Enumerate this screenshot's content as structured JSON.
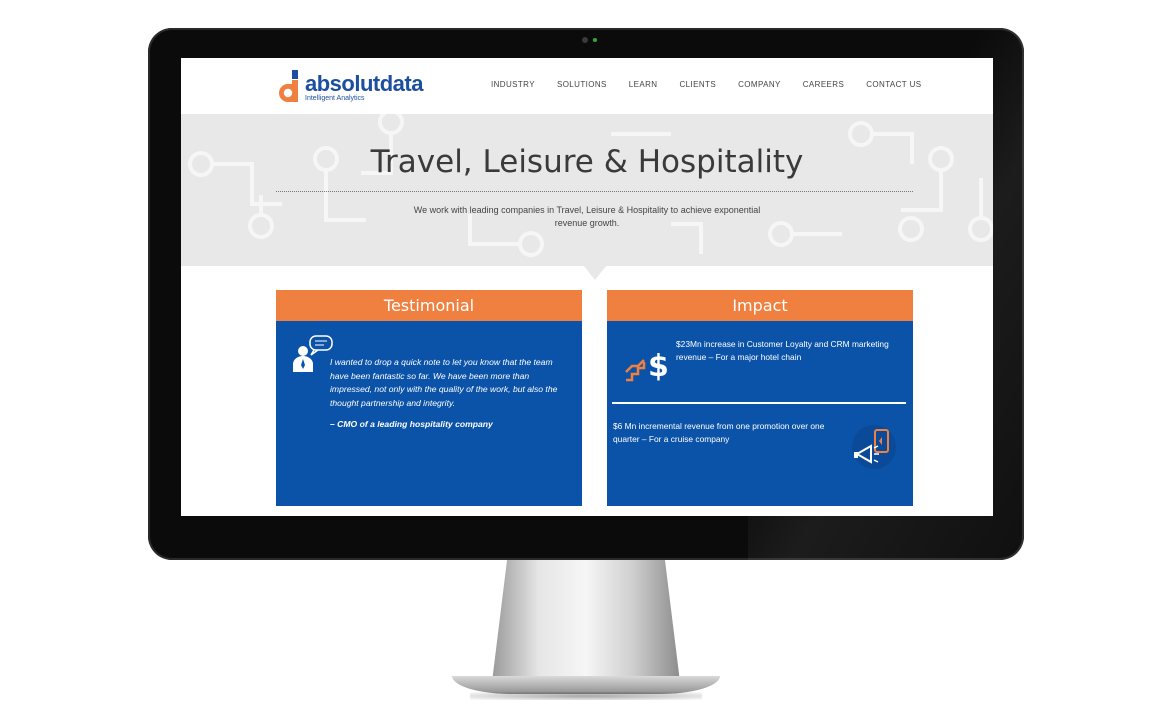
{
  "brand": {
    "name": "absolutdata",
    "tagline": "Intelligent Analytics",
    "logo_mark": "orange-d-logo",
    "colors": {
      "blue": "#1d4fa0",
      "orange": "#f08040"
    }
  },
  "nav": {
    "items": [
      {
        "label": "INDUSTRY"
      },
      {
        "label": "SOLUTIONS"
      },
      {
        "label": "LEARN"
      },
      {
        "label": "CLIENTS"
      },
      {
        "label": "COMPANY"
      },
      {
        "label": "CAREERS"
      },
      {
        "label": "CONTACT US"
      }
    ]
  },
  "hero": {
    "title": "Travel, Leisure & Hospitality",
    "subtitle": "We work with leading companies in Travel, Leisure & Hospitality to achieve exponential revenue growth."
  },
  "testimonial": {
    "header": "Testimonial",
    "icon": "speaking-person-icon",
    "quote": "I wanted to drop a quick note to let you know that the team have been fantastic so far. We have been more than impressed, not only with the quality of the work, but also the thought partnership and integrity.",
    "author": "– CMO of a leading hospitality company"
  },
  "impact": {
    "header": "Impact",
    "items": [
      {
        "icon": "dollar-growth-icon",
        "text": "$23Mn increase in Customer Loyalty and CRM marketing revenue – For a major hotel chain"
      },
      {
        "icon": "mobile-promotion-icon",
        "text": "$6 Mn incremental revenue from one promotion over one quarter – For a cruise company"
      }
    ],
    "card_color": "#0b53a8"
  }
}
